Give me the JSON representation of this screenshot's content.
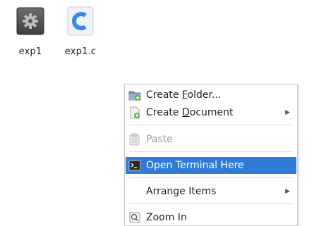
{
  "desktop": {
    "files": [
      {
        "name": "exp1",
        "icon": "executable-gear-icon"
      },
      {
        "name": "exp1.c",
        "icon": "c-source-file-icon"
      }
    ]
  },
  "context_menu": {
    "create_folder": {
      "prefix": "Create ",
      "mnemonic": "F",
      "suffix": "older...",
      "icon": "folder-new-icon"
    },
    "create_document": {
      "prefix": "Create ",
      "mnemonic": "D",
      "suffix": "ocument",
      "icon": "document-new-icon",
      "has_submenu": true
    },
    "paste": {
      "label": "Paste",
      "icon": "paste-icon",
      "disabled": true
    },
    "open_terminal": {
      "label": "Open Terminal Here",
      "icon": "terminal-icon",
      "highlighted": true
    },
    "arrange_items": {
      "label": "Arrange Items",
      "has_submenu": true
    },
    "zoom_in": {
      "label": "Zoom In",
      "icon": "zoom-in-icon"
    }
  },
  "colors": {
    "highlight": "#2f7bd6",
    "menu_border": "#c9c9c9"
  }
}
